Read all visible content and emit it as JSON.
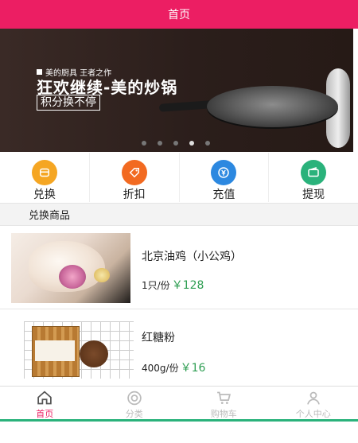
{
  "header": {
    "title": "首页"
  },
  "banner": {
    "small_text": "美的厨具 王者之作",
    "headline": "狂欢继续-美的炒锅",
    "tag": "积分换不停"
  },
  "quick_actions": [
    {
      "label": "兑换",
      "icon": "exchange-icon",
      "color": "#f5a623"
    },
    {
      "label": "折扣",
      "icon": "discount-tag-icon",
      "color": "#f26a21"
    },
    {
      "label": "充值",
      "icon": "recharge-yen-icon",
      "color": "#2c88e0"
    },
    {
      "label": "提现",
      "icon": "wallet-icon",
      "color": "#2ab27b"
    }
  ],
  "section": {
    "title": "兑换商品"
  },
  "products": [
    {
      "name": "北京油鸡（小公鸡）",
      "unit": "1只/份",
      "price": "￥128"
    },
    {
      "name": "红糖粉",
      "unit": "400g/份",
      "price": "￥16"
    }
  ],
  "nav": [
    {
      "label": "首页",
      "icon": "home-icon"
    },
    {
      "label": "分类",
      "icon": "category-target-icon"
    },
    {
      "label": "购物车",
      "icon": "cart-icon"
    },
    {
      "label": "个人中心",
      "icon": "user-icon"
    }
  ],
  "colors": {
    "brand": "#ec1e63",
    "price": "#2e9e52",
    "nav_active": "#ec1e63",
    "nav_inactive": "#bbbbbb"
  }
}
